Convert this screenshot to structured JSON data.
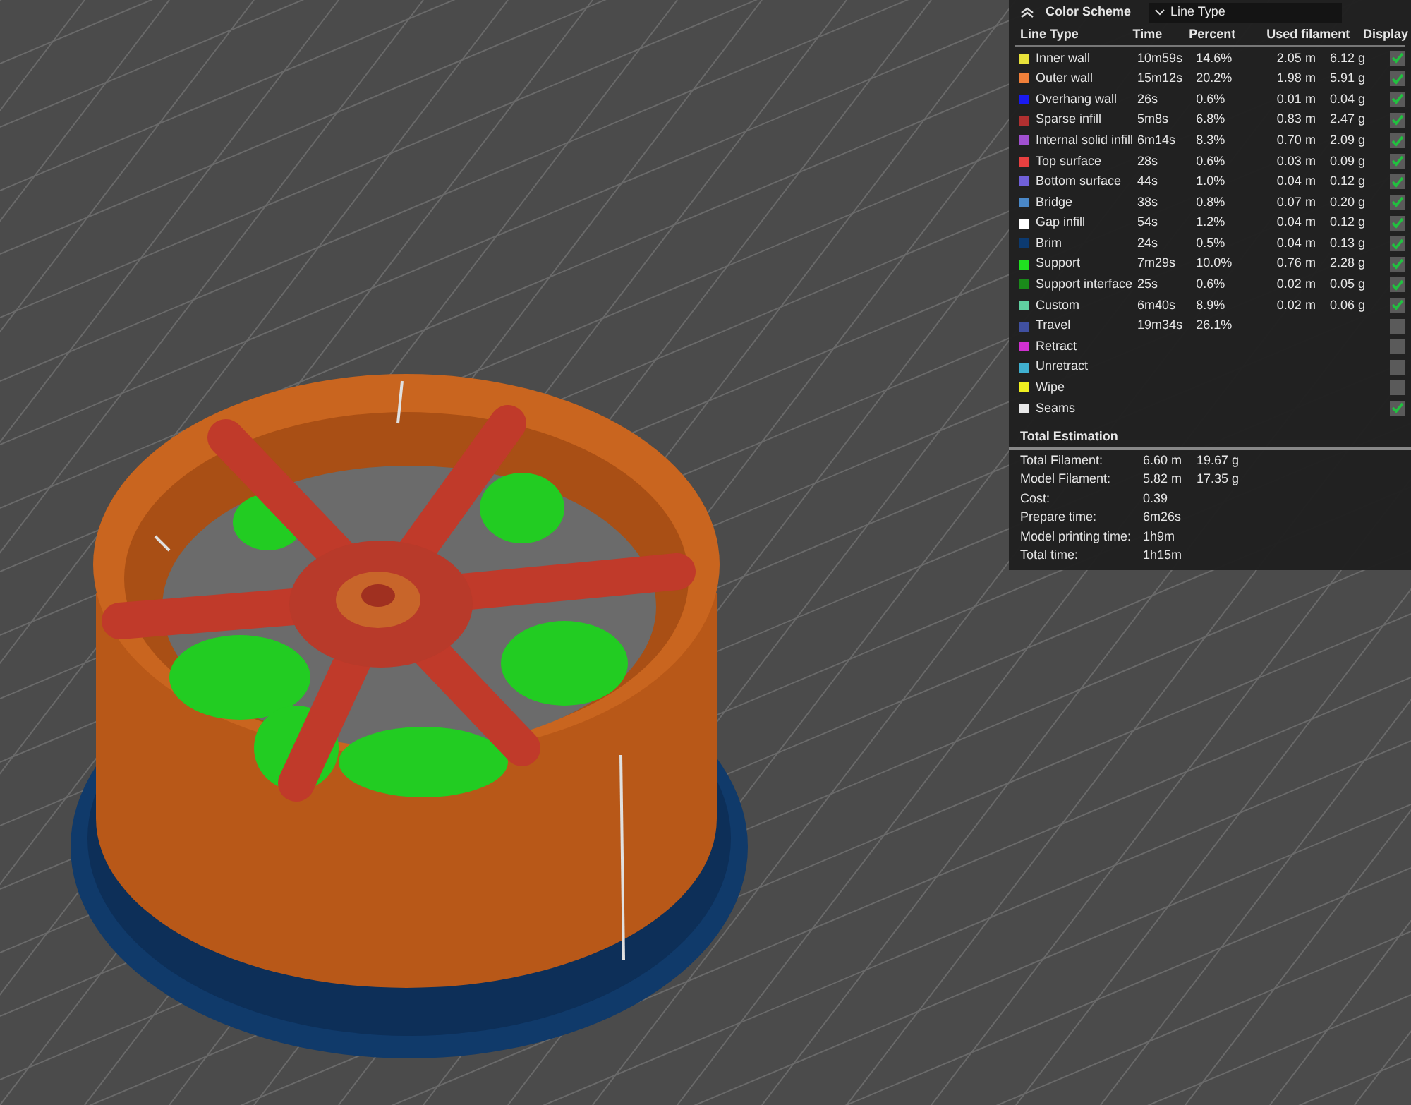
{
  "legend": {
    "title": "Color Scheme",
    "scheme_dropdown": {
      "value": "Line Type"
    },
    "columns": [
      "Line Type",
      "Time",
      "Percent",
      "Used filament",
      "Display"
    ],
    "rows": [
      {
        "name": "Inner wall",
        "color": "#e8e23a",
        "time": "10m59s",
        "percent": "14.6%",
        "length": "2.05 m",
        "weight": "6.12 g",
        "display": true
      },
      {
        "name": "Outer wall",
        "color": "#f0803a",
        "time": "15m12s",
        "percent": "20.2%",
        "length": "1.98 m",
        "weight": "5.91 g",
        "display": true
      },
      {
        "name": "Overhang wall",
        "color": "#1a1af0",
        "time": "26s",
        "percent": "0.6%",
        "length": "0.01 m",
        "weight": "0.04 g",
        "display": true
      },
      {
        "name": "Sparse infill",
        "color": "#b03030",
        "time": "5m8s",
        "percent": "6.8%",
        "length": "0.83 m",
        "weight": "2.47 g",
        "display": true
      },
      {
        "name": "Internal solid infill",
        "color": "#a050d0",
        "time": "6m14s",
        "percent": "8.3%",
        "length": "0.70 m",
        "weight": "2.09 g",
        "display": true
      },
      {
        "name": "Top surface",
        "color": "#e84040",
        "time": "28s",
        "percent": "0.6%",
        "length": "0.03 m",
        "weight": "0.09 g",
        "display": true
      },
      {
        "name": "Bottom surface",
        "color": "#7060d8",
        "time": "44s",
        "percent": "1.0%",
        "length": "0.04 m",
        "weight": "0.12 g",
        "display": true
      },
      {
        "name": "Bridge",
        "color": "#4a88c8",
        "time": "38s",
        "percent": "0.8%",
        "length": "0.07 m",
        "weight": "0.20 g",
        "display": true
      },
      {
        "name": "Gap infill",
        "color": "#ffffff",
        "time": "54s",
        "percent": "1.2%",
        "length": "0.04 m",
        "weight": "0.12 g",
        "display": true
      },
      {
        "name": "Brim",
        "color": "#0c3a70",
        "time": "24s",
        "percent": "0.5%",
        "length": "0.04 m",
        "weight": "0.13 g",
        "display": true
      },
      {
        "name": "Support",
        "color": "#20e020",
        "time": "7m29s",
        "percent": "10.0%",
        "length": "0.76 m",
        "weight": "2.28 g",
        "display": true
      },
      {
        "name": "Support interface",
        "color": "#1a8a1a",
        "time": "25s",
        "percent": "0.6%",
        "length": "0.02 m",
        "weight": "0.05 g",
        "display": true
      },
      {
        "name": "Custom",
        "color": "#60d0a0",
        "time": "6m40s",
        "percent": "8.9%",
        "length": "0.02 m",
        "weight": "0.06 g",
        "display": true
      },
      {
        "name": "Travel",
        "color": "#4050a0",
        "time": "19m34s",
        "percent": "26.1%",
        "display": false
      },
      {
        "name": "Retract",
        "color": "#d030d0",
        "display": false
      },
      {
        "name": "Unretract",
        "color": "#40b0d0",
        "display": false
      },
      {
        "name": "Wipe",
        "color": "#f0f020",
        "display": false
      },
      {
        "name": "Seams",
        "color": "#e8e8e8",
        "display": true
      }
    ]
  },
  "total_estimation": {
    "title": "Total Estimation",
    "rows": [
      {
        "label": "Total Filament:",
        "values": [
          "6.60 m",
          "19.67 g"
        ]
      },
      {
        "label": "Model Filament:",
        "values": [
          "5.82 m",
          "17.35 g"
        ]
      },
      {
        "label": "Cost:",
        "values": [
          "0.39"
        ]
      },
      {
        "label": "Prepare time:",
        "values": [
          "6m26s"
        ]
      },
      {
        "label": "Model printing time:",
        "values": [
          "1h9m"
        ]
      },
      {
        "label": "Total time:",
        "values": [
          "1h15m"
        ]
      }
    ]
  }
}
